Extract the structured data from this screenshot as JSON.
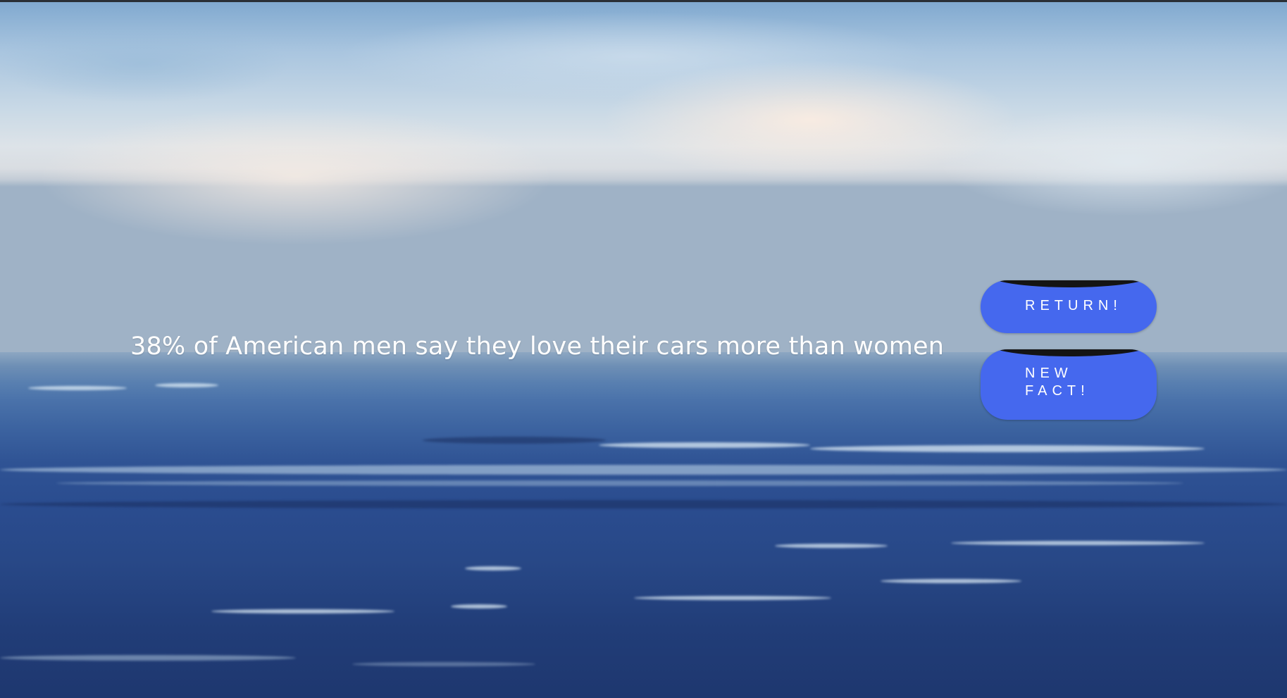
{
  "fact": {
    "text": "38% of American men say they love their cars more than women"
  },
  "buttons": {
    "return_label": "RETURN!",
    "new_fact_label": "NEW FACT!"
  },
  "colors": {
    "button_fill": "#4568ee",
    "button_cap": "#141414",
    "text": "#ffffff"
  },
  "background": {
    "scene": "ocean-horizon-under-cloudy-sky"
  }
}
